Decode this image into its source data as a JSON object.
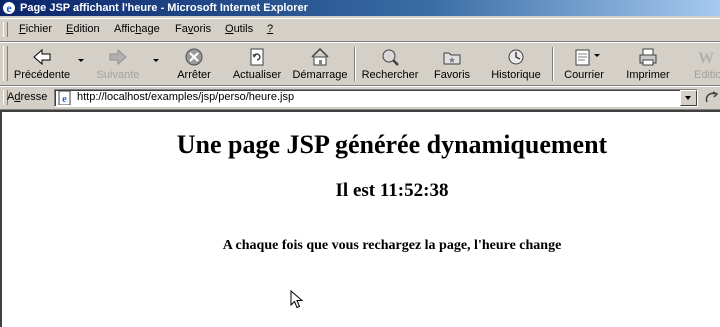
{
  "window": {
    "title": "Page JSP affichant l'heure - Microsoft Internet Explorer"
  },
  "menu": {
    "items": [
      {
        "pre": "",
        "accel": "F",
        "post": "ichier"
      },
      {
        "pre": "",
        "accel": "E",
        "post": "dition"
      },
      {
        "pre": "Affic",
        "accel": "h",
        "post": "age"
      },
      {
        "pre": "Fa",
        "accel": "v",
        "post": "oris"
      },
      {
        "pre": "",
        "accel": "O",
        "post": "utils"
      },
      {
        "pre": "",
        "accel": "?",
        "post": ""
      }
    ]
  },
  "toolbar": {
    "back": "Précédente",
    "forward": "Suivante",
    "stop": "Arrêter",
    "refresh": "Actualiser",
    "home": "Démarrage",
    "search": "Rechercher",
    "favorites": "Favoris",
    "history": "Historique",
    "mail": "Courrier",
    "print": "Imprimer",
    "edit": "Editio"
  },
  "address": {
    "label_pre": "A",
    "label_accel": "d",
    "label_post": "resse",
    "url": "http://localhost/examples/jsp/perso/heure.jsp"
  },
  "page": {
    "heading": "Une page JSP générée dynamiquement",
    "time": "Il est 11:52:38",
    "note": "A chaque fois que vous rechargez la page, l'heure change"
  },
  "colors": {
    "titlebar_start": "#0a246a",
    "titlebar_end": "#a6caf0",
    "chrome": "#d4d0c8"
  }
}
